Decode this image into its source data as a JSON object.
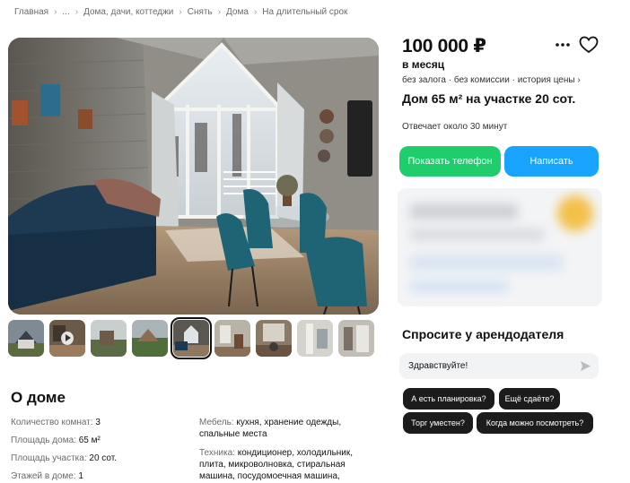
{
  "breadcrumb": {
    "items": [
      "Главная",
      "...",
      "Дома, дачи, коттеджи",
      "Снять",
      "Дома",
      "На длительный срок"
    ],
    "separator": "›"
  },
  "listing": {
    "price": "100 000 ₽",
    "period": "в месяц",
    "tags": "без залога · без комиссии · история цены ›",
    "title": "Дом 65 м² на участке 20 сот.",
    "response_time": "Отвечает около 30 минут",
    "show_phone_label": "Показать телефон",
    "write_label": "Написать"
  },
  "gallery": {
    "thumbnail_count": 9,
    "active_thumbnail": 5,
    "video_thumbnail": 2
  },
  "about": {
    "title": "О доме",
    "left": [
      {
        "k": "Количество комнат:",
        "v": "3"
      },
      {
        "k": "Площадь дома:",
        "v": "65 м²"
      },
      {
        "k": "Площадь участка:",
        "v": "20 сот."
      },
      {
        "k": "Этажей в доме:",
        "v": "1"
      }
    ],
    "right": [
      {
        "k": "Мебель:",
        "v": "кухня, хранение одежды, спальные места"
      },
      {
        "k": "Техника:",
        "v": "кондиционер, холодильник, плита, микроволновка, стиральная машина, посудомоечная машина,"
      }
    ]
  },
  "ask": {
    "title": "Спросите у арендодателя",
    "message_value": "Здравствуйте!",
    "chips": [
      "А есть планировка?",
      "Ещё сдаёте?",
      "Торг уместен?",
      "Когда можно посмотреть?"
    ]
  },
  "colors": {
    "phone_button": "#1fcd6d",
    "write_button": "#18a3ff",
    "chip_bg": "#1c1c1c"
  },
  "icons": [
    "more-icon",
    "heart-icon",
    "send-icon",
    "play-icon"
  ]
}
